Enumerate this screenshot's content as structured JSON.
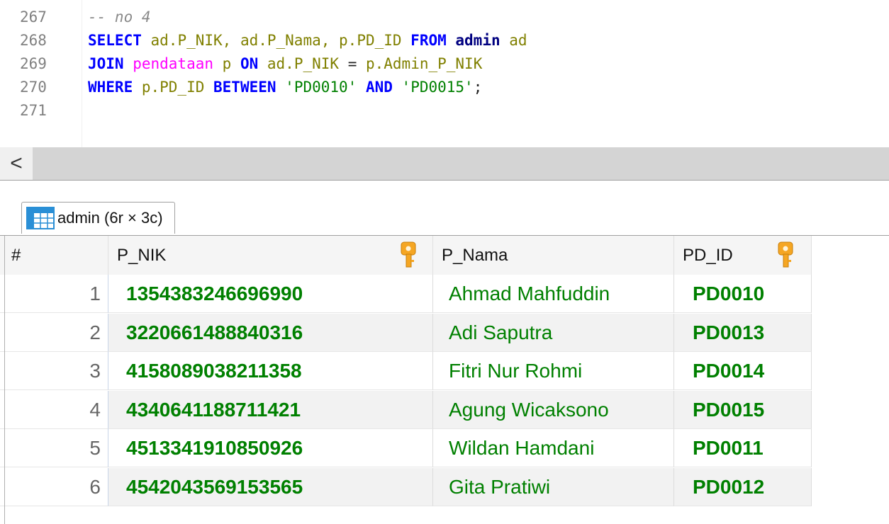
{
  "editor": {
    "lines": [
      {
        "number": "267",
        "tokens": [
          {
            "t": "-- no 4",
            "c": "tk-comment"
          }
        ]
      },
      {
        "number": "268",
        "tokens": [
          {
            "t": "SELECT",
            "c": "tk-kw"
          },
          {
            "t": " ad.",
            "c": "tk-ident"
          },
          {
            "t": "P_NIK",
            "c": "tk-ident"
          },
          {
            "t": ", ad.",
            "c": "tk-ident"
          },
          {
            "t": "P_Nama",
            "c": "tk-ident"
          },
          {
            "t": ", p.",
            "c": "tk-ident"
          },
          {
            "t": "PD_ID",
            "c": "tk-ident"
          },
          {
            "t": " FROM",
            "c": "tk-kw"
          },
          {
            "t": " admin",
            "c": "tk-tbold"
          },
          {
            "t": " ad",
            "c": "tk-ident"
          }
        ]
      },
      {
        "number": "269",
        "tokens": [
          {
            "t": "JOIN",
            "c": "tk-kw"
          },
          {
            "t": " pendataan",
            "c": "tk-table"
          },
          {
            "t": " p",
            "c": "tk-ident"
          },
          {
            "t": " ON",
            "c": "tk-kw"
          },
          {
            "t": " ad.P_NIK",
            "c": "tk-ident"
          },
          {
            "t": " = ",
            "c": "tk-plain"
          },
          {
            "t": "p.Admin_P_NIK",
            "c": "tk-ident"
          }
        ]
      },
      {
        "number": "270",
        "tokens": [
          {
            "t": "WHERE",
            "c": "tk-kw"
          },
          {
            "t": " p.PD_ID",
            "c": "tk-ident"
          },
          {
            "t": " BETWEEN",
            "c": "tk-kw"
          },
          {
            "t": " 'PD0010'",
            "c": "tk-str"
          },
          {
            "t": " AND",
            "c": "tk-kw"
          },
          {
            "t": " 'PD0015'",
            "c": "tk-str"
          },
          {
            "t": ";",
            "c": "tk-plain"
          }
        ]
      },
      {
        "number": "271",
        "tokens": []
      }
    ]
  },
  "scrollbar": {
    "left_arrow": "<"
  },
  "result_tab": {
    "label": "admin (6r × 3c)",
    "icon": "table-grid-icon"
  },
  "grid": {
    "headers": {
      "num": "#",
      "nik": "P_NIK",
      "nama": "P_Nama",
      "pd": "PD_ID"
    },
    "rows": [
      {
        "num": "1",
        "nik": "1354383246696990",
        "nama": "Ahmad Mahfuddin",
        "pd": "PD0010"
      },
      {
        "num": "2",
        "nik": "3220661488840316",
        "nama": "Adi Saputra",
        "pd": "PD0013"
      },
      {
        "num": "3",
        "nik": "4158089038211358",
        "nama": "Fitri Nur Rohmi",
        "pd": "PD0014"
      },
      {
        "num": "4",
        "nik": "4340641188711421",
        "nama": "Agung Wicaksono",
        "pd": "PD0015"
      },
      {
        "num": "5",
        "nik": "4513341910850926",
        "nama": "Wildan Hamdani",
        "pd": "PD0011"
      },
      {
        "num": "6",
        "nik": "4542043569153565",
        "nama": "Gita Pratiwi",
        "pd": "PD0012"
      }
    ]
  },
  "colors": {
    "keyword": "#0000ff",
    "value_green": "#008000",
    "table_magenta": "#ff00ff",
    "key_icon": "#f5a623"
  }
}
